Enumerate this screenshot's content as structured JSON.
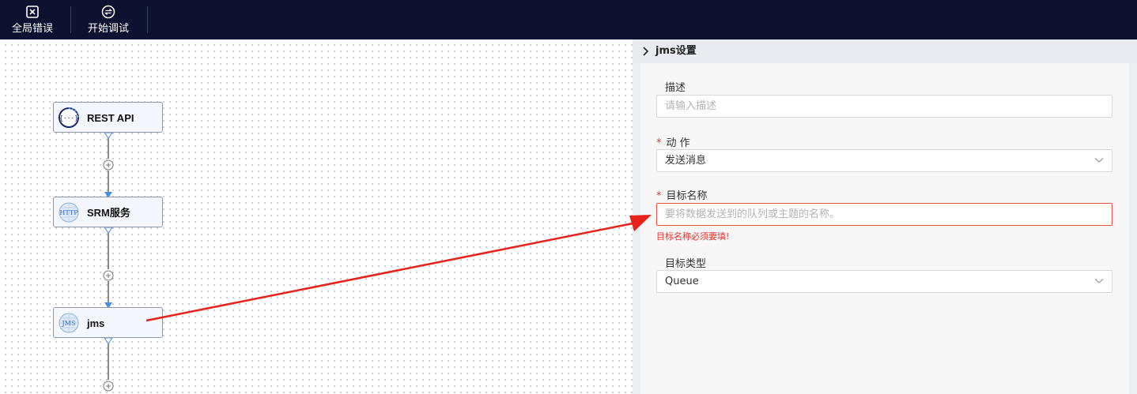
{
  "toolbar": {
    "global_error_label": "全局错误",
    "start_debug_label": "开始调试"
  },
  "flow": {
    "nodes": [
      {
        "label": "REST API",
        "icon": "rest-api-icon"
      },
      {
        "label": "SRM服务",
        "icon": "http-icon"
      },
      {
        "label": "jms",
        "icon": "jms-icon"
      }
    ]
  },
  "panel": {
    "title": "jms设置",
    "description": {
      "label": "描述",
      "placeholder": "请输入描述"
    },
    "action": {
      "required_mark": "*",
      "label": "动 作",
      "value": "发送消息"
    },
    "target_name": {
      "required_mark": "*",
      "label": "目标名称",
      "placeholder": "要将数据发送到的队列或主题的名称。",
      "error": "目标名称必须要填!"
    },
    "target_type": {
      "label": "目标类型",
      "value": "Queue"
    }
  },
  "colors": {
    "toolbar_bg": "#0c1230",
    "error": "#e8332a",
    "edge": "#4a90e2"
  }
}
